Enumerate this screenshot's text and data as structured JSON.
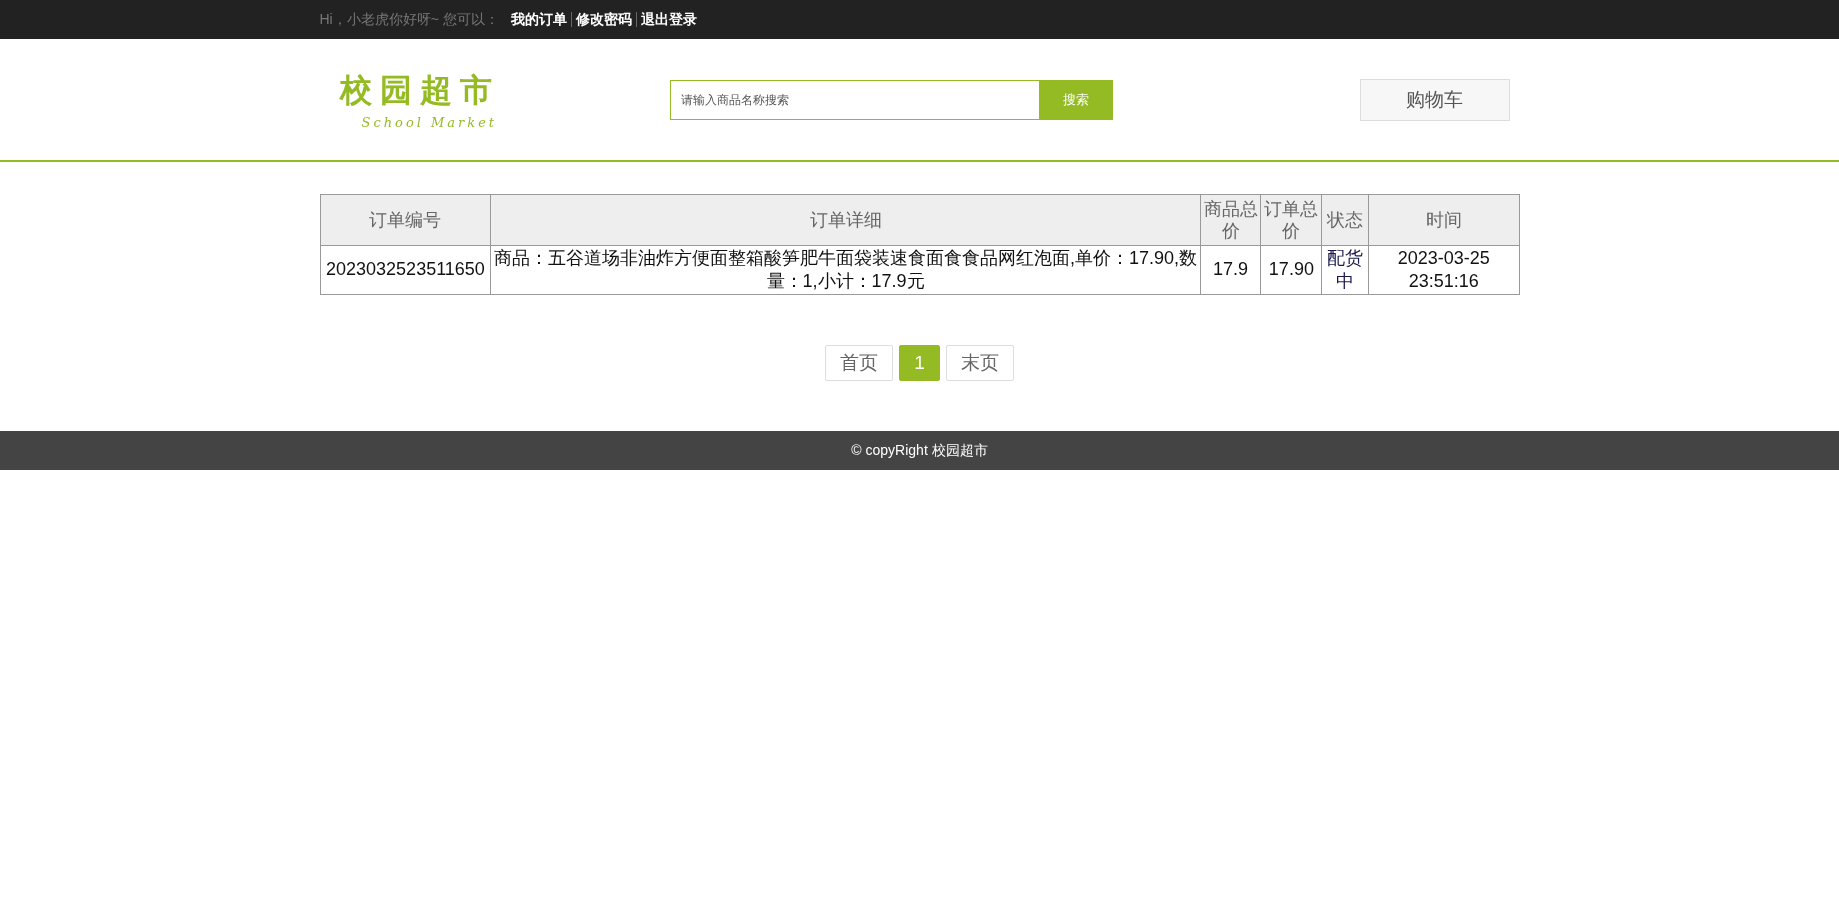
{
  "top_bar": {
    "greeting": "Hi，小老虎你好呀~ 您可以：",
    "links": [
      "我的订单",
      "修改密码",
      "退出登录"
    ]
  },
  "logo": {
    "title": "校园超市",
    "subtitle": "School Market"
  },
  "search": {
    "placeholder": "请输入商品名称搜索",
    "button": "搜索"
  },
  "cart_button": "购物车",
  "table": {
    "columns": [
      "订单编号",
      "订单详细",
      "商品总价",
      "订单总价",
      "状态",
      "时间"
    ],
    "rows": [
      {
        "cells": [
          "2023032523511650",
          "商品：五谷道场非油炸方便面整箱酸笋肥牛面袋装速食面食食品网红泡面,单价：17.90,数量：1,小计：17.9元",
          "17.9",
          "17.90",
          "配货中",
          "2023-03-25 23:51:16"
        ]
      }
    ]
  },
  "pagination": [
    {
      "label": "首页",
      "selected": false
    },
    {
      "label": "1",
      "selected": true
    },
    {
      "label": "末页",
      "selected": false
    }
  ],
  "footer": "© copyRight 校园超市"
}
